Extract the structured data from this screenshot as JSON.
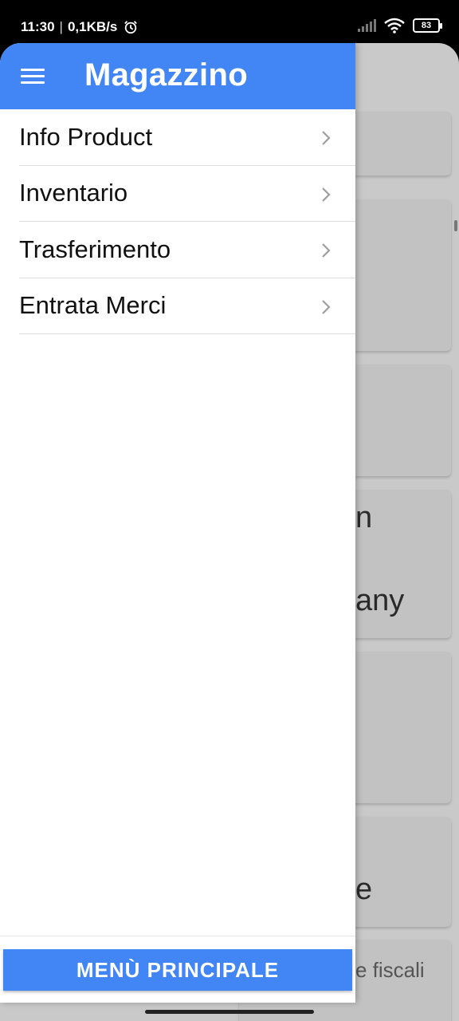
{
  "status_bar": {
    "time": "11:30",
    "separator": "|",
    "network_speed": "0,1KB/s",
    "battery_level": "83",
    "icons": [
      "alarm-icon",
      "signal-icon",
      "wifi-icon",
      "battery-icon"
    ]
  },
  "drawer": {
    "title": "Magazzino",
    "menu_icon": "hamburger-menu-icon",
    "items": [
      {
        "label": "Info Product",
        "icon": "chevron-right-icon"
      },
      {
        "label": "Inventario",
        "icon": "chevron-right-icon"
      },
      {
        "label": "Trasferimento",
        "icon": "chevron-right-icon"
      },
      {
        "label": "Entrata Merci",
        "icon": "chevron-right-icon"
      }
    ],
    "footer_button": "MENÙ PRINCIPALE"
  },
  "background": {
    "partial_texts": [
      "n",
      "any",
      "e",
      "e fiscali"
    ]
  },
  "colors": {
    "primary": "#4285f4",
    "scrim": "#c9c9c9"
  }
}
